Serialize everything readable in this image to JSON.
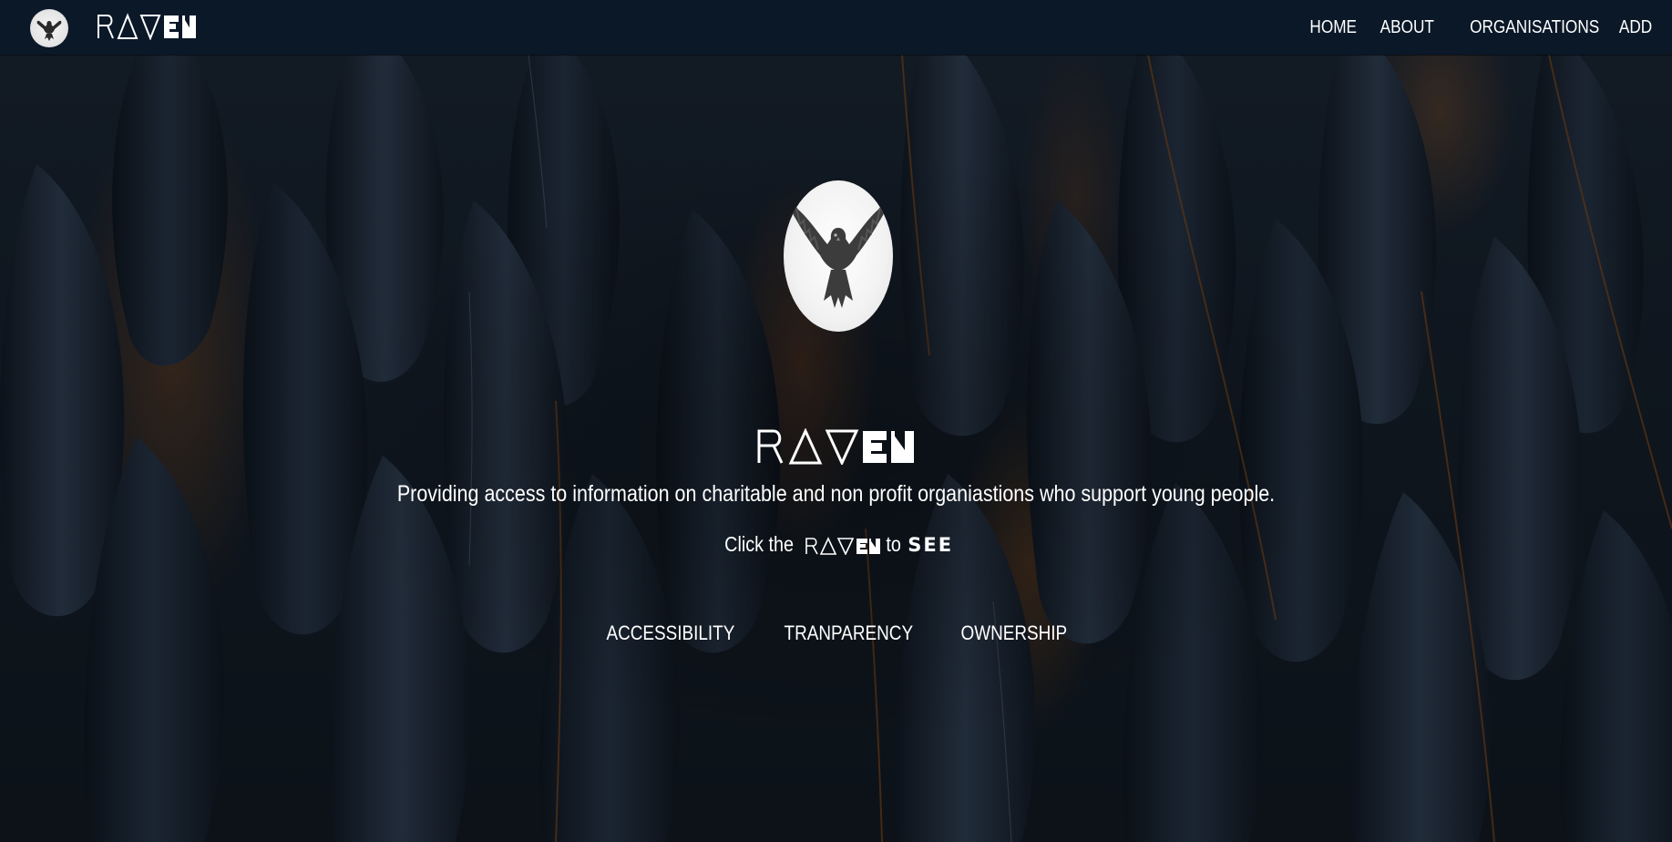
{
  "brand": {
    "name": "RAVEN",
    "logo_icon": "raven-emblem-icon"
  },
  "nav": {
    "items": [
      {
        "label": "HOME"
      },
      {
        "label": "ABOUT"
      },
      {
        "label": "ORGANISATIONS"
      },
      {
        "label": "ADD"
      }
    ]
  },
  "hero": {
    "title": "RAVEN",
    "tagline": "Providing access to information on charitable and non profit organiastions who support young people.",
    "cta_prefix": "Click the",
    "cta_brand": "RAVEN",
    "cta_middle": "to",
    "cta_action": "SEE",
    "pillars": [
      {
        "label": "ACCESSIBILITY"
      },
      {
        "label": "TRANPARENCY"
      },
      {
        "label": "OWNERSHIP"
      }
    ]
  },
  "colors": {
    "navbar_bg": "#0a1828",
    "text": "#ffffff",
    "feather_accent": "#7a4a1e"
  }
}
